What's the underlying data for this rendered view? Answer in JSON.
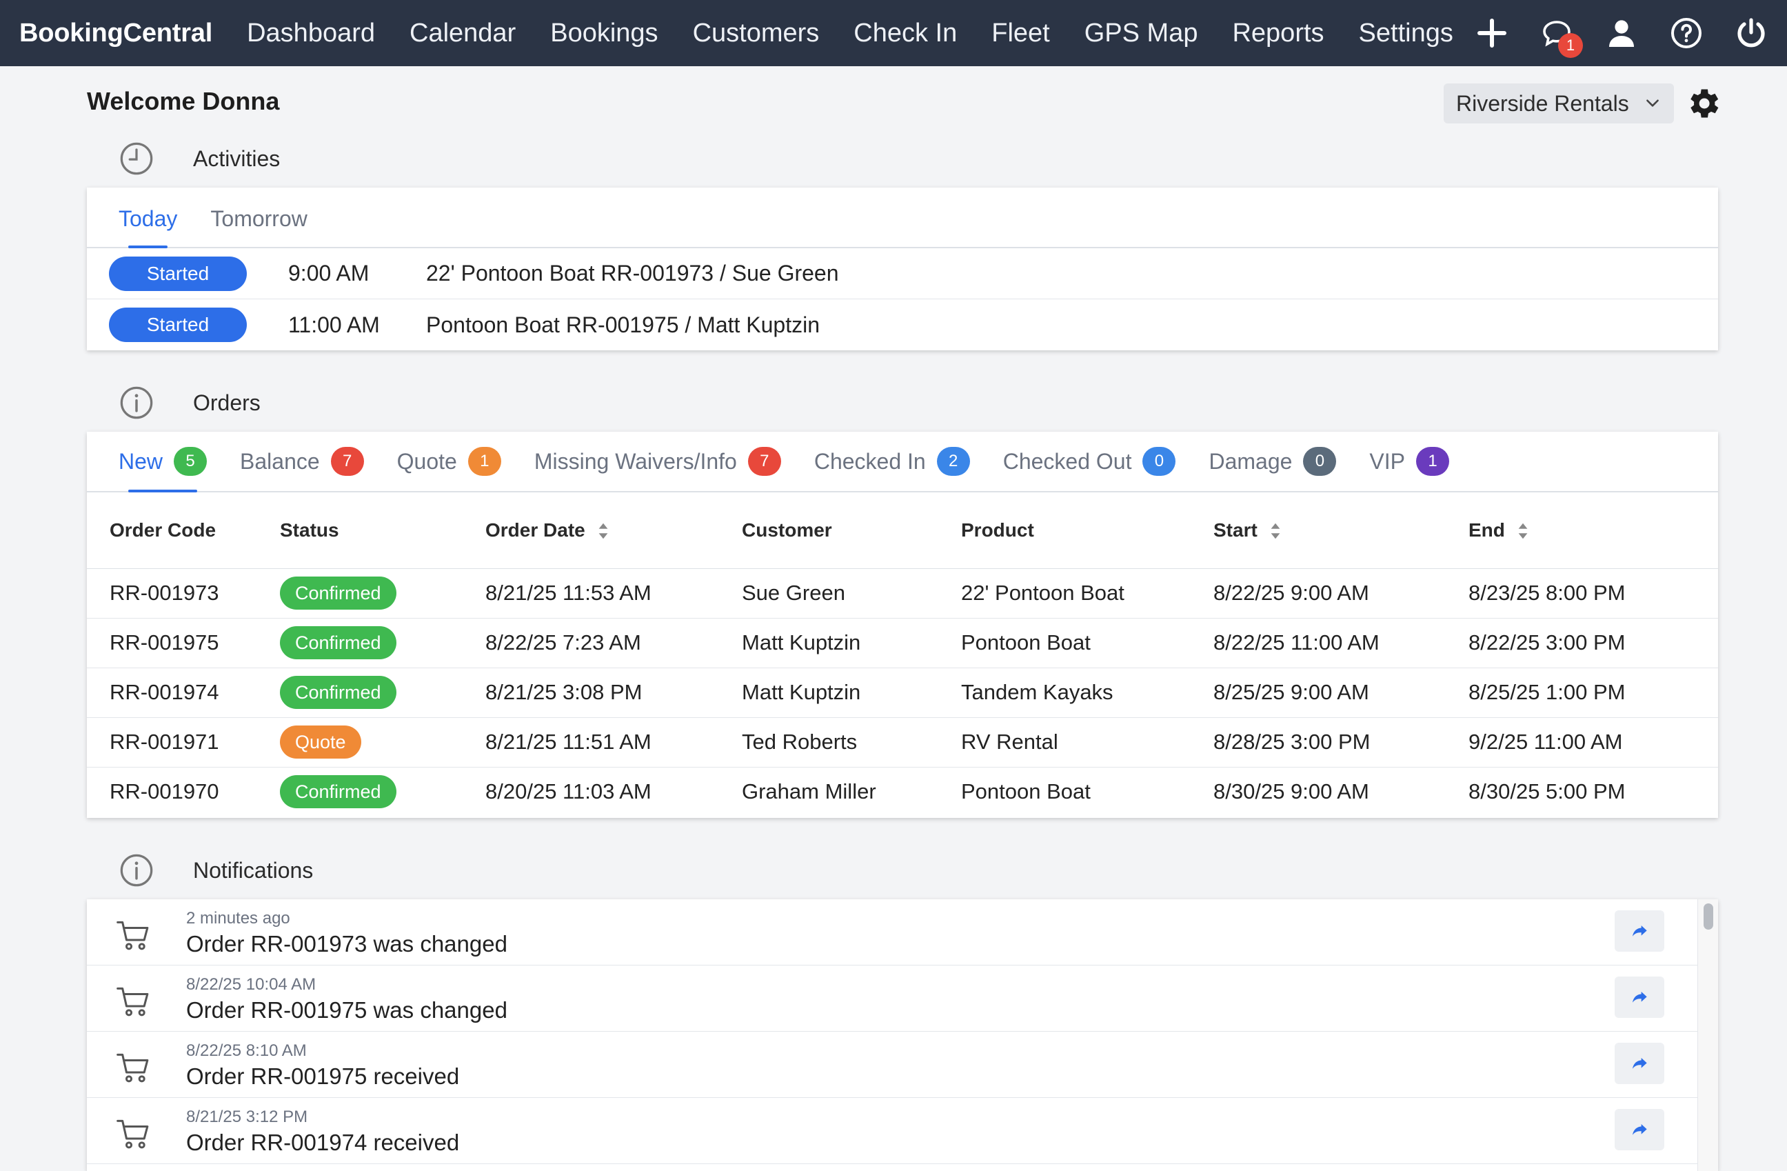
{
  "nav": {
    "brand": "BookingCentral",
    "links": [
      "Dashboard",
      "Calendar",
      "Bookings",
      "Customers",
      "Check In",
      "Fleet",
      "GPS Map",
      "Reports",
      "Settings"
    ],
    "icons": [
      "plus-icon",
      "chat-icon",
      "user-icon",
      "help-icon",
      "power-icon"
    ],
    "chat_badge": "1"
  },
  "header": {
    "welcome": "Welcome Donna",
    "location": "Riverside Rentals"
  },
  "activities": {
    "title": "Activities",
    "tabs": [
      "Today",
      "Tomorrow"
    ],
    "active_tab": "Today",
    "rows": [
      {
        "status": "Started",
        "time": "9:00 AM",
        "desc": "22' Pontoon Boat RR-001973 / Sue Green"
      },
      {
        "status": "Started",
        "time": "11:00 AM",
        "desc": "Pontoon Boat RR-001975 / Matt Kuptzin"
      }
    ]
  },
  "orders": {
    "title": "Orders",
    "tabs": [
      {
        "label": "New",
        "count": "5",
        "color": "#3fb950"
      },
      {
        "label": "Balance",
        "count": "7",
        "color": "#e8483b"
      },
      {
        "label": "Quote",
        "count": "1",
        "color": "#f08a36"
      },
      {
        "label": "Missing Waivers/Info",
        "count": "7",
        "color": "#e8483b"
      },
      {
        "label": "Checked In",
        "count": "2",
        "color": "#3a86e8"
      },
      {
        "label": "Checked Out",
        "count": "0",
        "color": "#3a86e8"
      },
      {
        "label": "Damage",
        "count": "0",
        "color": "#5b6b7b"
      },
      {
        "label": "VIP",
        "count": "1",
        "color": "#6a3bbd"
      }
    ],
    "columns": [
      "Order Code",
      "Status",
      "Order Date",
      "Customer",
      "Product",
      "Start",
      "End"
    ],
    "rows": [
      {
        "code": "RR-001973",
        "status": "Confirmed",
        "status_color": "#3fb950",
        "order_date": "8/21/25 11:53 AM",
        "customer": "Sue Green",
        "product": "22' Pontoon Boat",
        "start": "8/22/25 9:00 AM",
        "end": "8/23/25 8:00 PM"
      },
      {
        "code": "RR-001975",
        "status": "Confirmed",
        "status_color": "#3fb950",
        "order_date": "8/22/25 7:23 AM",
        "customer": "Matt Kuptzin",
        "product": "Pontoon Boat",
        "start": "8/22/25 11:00 AM",
        "end": "8/22/25 3:00 PM"
      },
      {
        "code": "RR-001974",
        "status": "Confirmed",
        "status_color": "#3fb950",
        "order_date": "8/21/25 3:08 PM",
        "customer": "Matt Kuptzin",
        "product": "Tandem Kayaks",
        "start": "8/25/25 9:00 AM",
        "end": "8/25/25 1:00 PM"
      },
      {
        "code": "RR-001971",
        "status": "Quote",
        "status_color": "#f08a36",
        "order_date": "8/21/25 11:51 AM",
        "customer": "Ted Roberts",
        "product": "RV Rental",
        "start": "8/28/25 3:00 PM",
        "end": "9/2/25 11:00 AM"
      },
      {
        "code": "RR-001970",
        "status": "Confirmed",
        "status_color": "#3fb950",
        "order_date": "8/20/25 11:03 AM",
        "customer": "Graham Miller",
        "product": "Pontoon Boat",
        "start": "8/30/25 9:00 AM",
        "end": "8/30/25 5:00 PM"
      }
    ]
  },
  "notifications": {
    "title": "Notifications",
    "items": [
      {
        "time": "2 minutes ago",
        "text": "Order RR-001973 was changed"
      },
      {
        "time": "8/22/25 10:04 AM",
        "text": "Order RR-001975 was changed"
      },
      {
        "time": "8/22/25 8:10 AM",
        "text": "Order RR-001975 received"
      },
      {
        "time": "8/21/25 3:12 PM",
        "text": "Order RR-001974 received"
      }
    ]
  }
}
